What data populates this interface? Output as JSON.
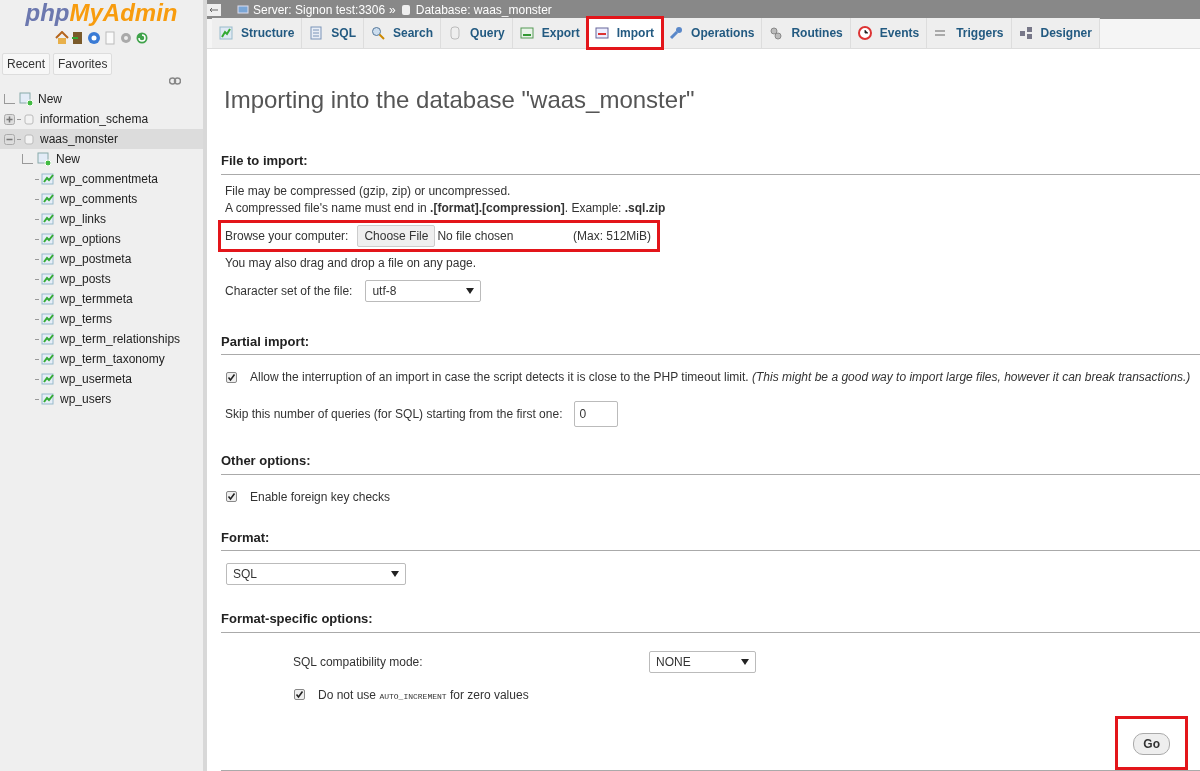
{
  "logo": {
    "part1": "php",
    "part2": "MyAdmin"
  },
  "sidebar": {
    "buttons": [
      "Recent",
      "Favorites"
    ],
    "tree": [
      {
        "label": "New",
        "kind": "new",
        "selected": false
      },
      {
        "label": "information_schema",
        "kind": "db",
        "expanded": false,
        "selected": false
      },
      {
        "label": "waas_monster",
        "kind": "db",
        "expanded": true,
        "selected": true,
        "children": [
          {
            "label": "New",
            "kind": "new",
            "selected": false
          },
          {
            "label": "wp_commentmeta",
            "kind": "table",
            "selected": false
          },
          {
            "label": "wp_comments",
            "kind": "table",
            "selected": false
          },
          {
            "label": "wp_links",
            "kind": "table",
            "selected": false
          },
          {
            "label": "wp_options",
            "kind": "table",
            "selected": false
          },
          {
            "label": "wp_postmeta",
            "kind": "table",
            "selected": false
          },
          {
            "label": "wp_posts",
            "kind": "table",
            "selected": false
          },
          {
            "label": "wp_termmeta",
            "kind": "table",
            "selected": false
          },
          {
            "label": "wp_terms",
            "kind": "table",
            "selected": false
          },
          {
            "label": "wp_term_relationships",
            "kind": "table",
            "selected": false
          },
          {
            "label": "wp_term_taxonomy",
            "kind": "table",
            "selected": false
          },
          {
            "label": "wp_usermeta",
            "kind": "table",
            "selected": false
          },
          {
            "label": "wp_users",
            "kind": "table",
            "selected": false
          }
        ]
      }
    ]
  },
  "breadcrumb": [
    "Server: Signon test:3306",
    "Database: waas_monster"
  ],
  "breadcrumb_separator": "»",
  "tabs": [
    {
      "label": "Structure",
      "selected": false,
      "highlighted": false
    },
    {
      "label": "SQL",
      "selected": false,
      "highlighted": false
    },
    {
      "label": "Search",
      "selected": false,
      "highlighted": false
    },
    {
      "label": "Query",
      "selected": false,
      "highlighted": false
    },
    {
      "label": "Export",
      "selected": false,
      "highlighted": false
    },
    {
      "label": "Import",
      "selected": true,
      "highlighted": true
    },
    {
      "label": "Operations",
      "selected": false,
      "highlighted": false
    },
    {
      "label": "Routines",
      "selected": false,
      "highlighted": false
    },
    {
      "label": "Events",
      "selected": false,
      "highlighted": false
    },
    {
      "label": "Triggers",
      "selected": false,
      "highlighted": false
    },
    {
      "label": "Designer",
      "selected": false,
      "highlighted": false
    }
  ],
  "page_title": "Importing into the database \"waas_monster\"",
  "file_to_import": {
    "heading": "File to import:",
    "note1": "File may be compressed (gzip, zip) or uncompressed.",
    "note2": "A compressed file's name must end in **.[format].[compression]**. Example: **.sql.zip**",
    "browse_label": "Browse your computer:",
    "choose_button": "Choose File",
    "file_status": "No file chosen",
    "max": "(Max: 512MiB)",
    "highlighted": true,
    "drag_note": "You may also drag and drop a file on any page.",
    "charset_label": "Character set of the file:",
    "charset_value": "utf-8"
  },
  "partial_import": {
    "heading": "Partial import:",
    "allow_label": "Allow the interruption of an import in case the script detects it is close to the PHP timeout limit. *(This might be a good way to import large files, however it can break transactions.)*",
    "allow_checked": true,
    "skip_label": "Skip this number of queries (for SQL) starting from the first one:",
    "skip_value": "0"
  },
  "other_options": {
    "heading": "Other options:",
    "fk_label": "Enable foreign key checks",
    "fk_checked": true
  },
  "format": {
    "heading": "Format:",
    "value": "SQL"
  },
  "format_specific": {
    "heading": "Format-specific options:",
    "compat_label": "SQL compatibility mode:",
    "compat_value": "NONE",
    "auto_inc_parts": [
      "Do not use ",
      "AUTO_INCREMENT",
      " for zero values"
    ],
    "auto_inc_checked": true
  },
  "go_button": {
    "label": "Go",
    "highlighted": true
  }
}
